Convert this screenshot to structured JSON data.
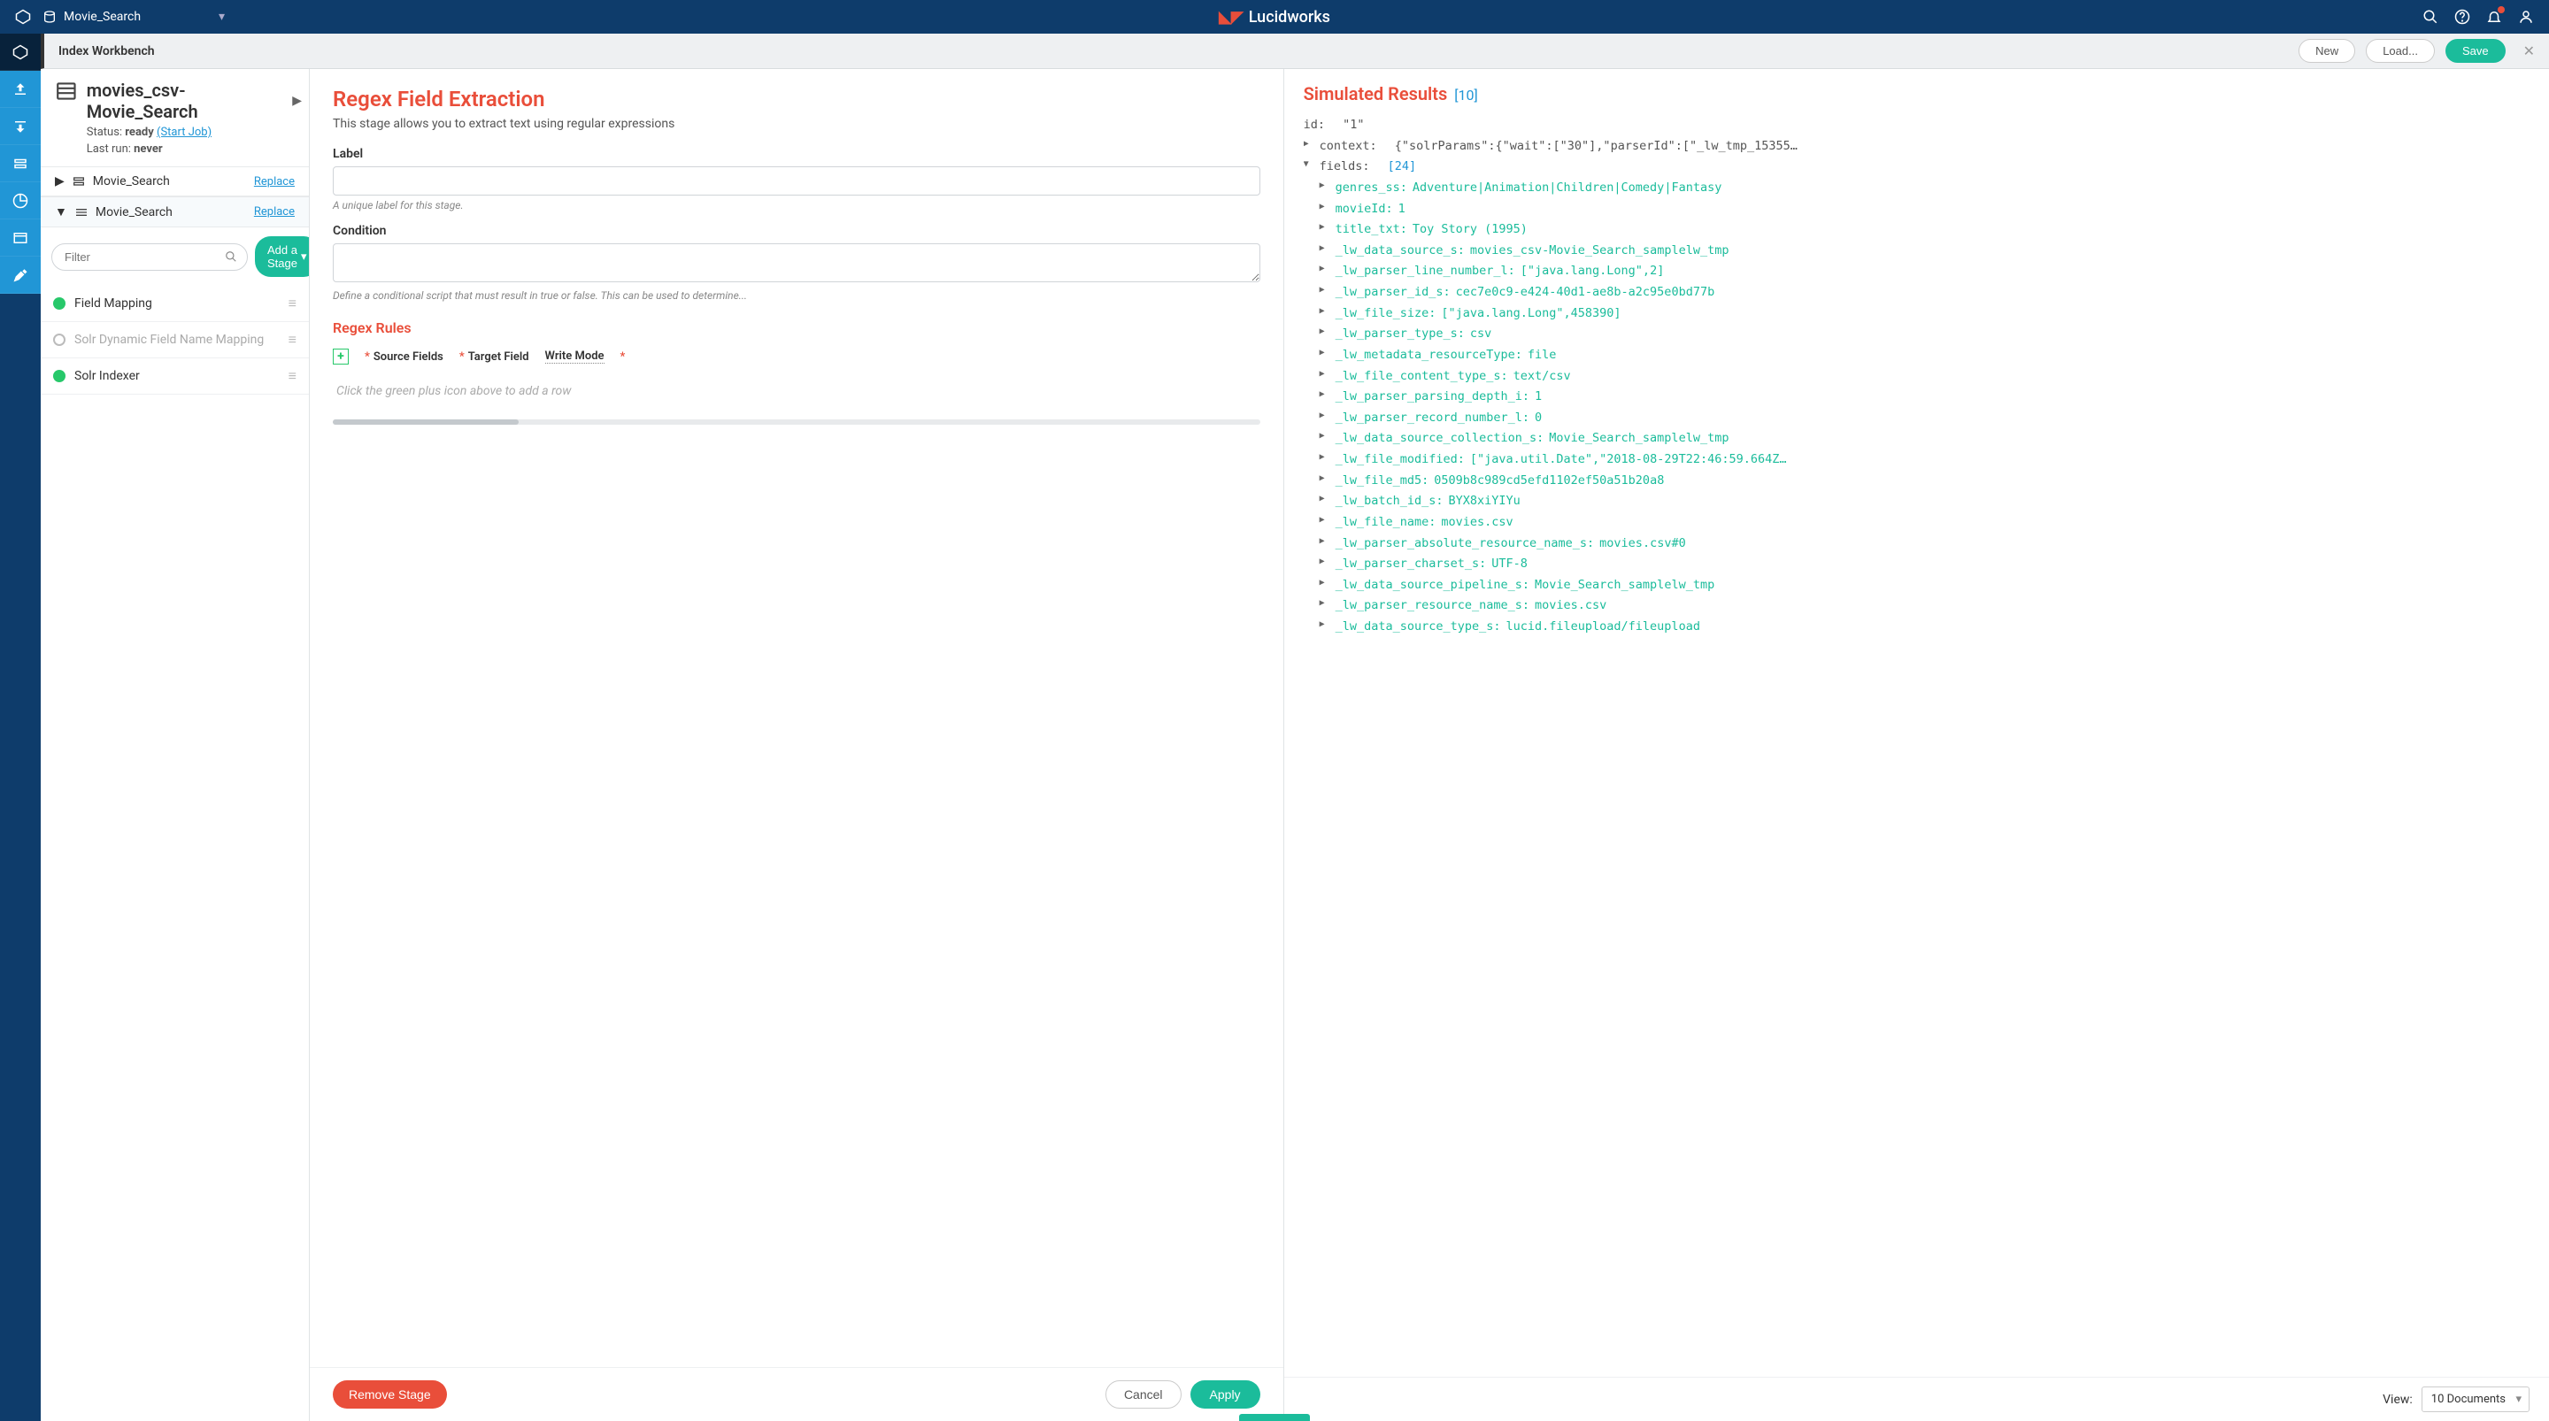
{
  "topbar": {
    "app_name": "Movie_Search",
    "brand": "Lucidworks"
  },
  "subbar": {
    "title": "Index Workbench",
    "new": "New",
    "load": "Load...",
    "save": "Save"
  },
  "datasource": {
    "title": "movies_csv-Movie_Search",
    "status_label": "Status:",
    "status_value": "ready",
    "start_job": "(Start Job)",
    "lastrun_label": "Last run:",
    "lastrun_value": "never"
  },
  "accordion": {
    "a1": "Movie_Search",
    "a2": "Movie_Search",
    "replace": "Replace"
  },
  "filter": {
    "placeholder": "Filter",
    "add_stage": "Add a Stage"
  },
  "stages": [
    {
      "label": "Field Mapping",
      "dim": false,
      "dot": "green"
    },
    {
      "label": "Solr Dynamic Field Name Mapping",
      "dim": true,
      "dot": "hollow"
    },
    {
      "label": "Solr Indexer",
      "dim": false,
      "dot": "green"
    }
  ],
  "form": {
    "title": "Regex Field Extraction",
    "desc": "This stage allows you to extract text using regular expressions",
    "label_label": "Label",
    "label_hint": "A unique label for this stage.",
    "condition_label": "Condition",
    "condition_hint": "Define a conditional script that must result in true or false. This can be used to determine...",
    "rules_title": "Regex Rules",
    "col_source": "Source Fields",
    "col_target": "Target Field",
    "col_write": "Write Mode",
    "rules_empty": "Click the green plus icon above to add a row",
    "remove": "Remove Stage",
    "cancel": "Cancel",
    "apply": "Apply"
  },
  "sim": {
    "title": "Simulated Results",
    "count": "[10]",
    "id_line_k": "id:",
    "id_line_v": "\"1\"",
    "context_k": "context:",
    "context_v": "{\"solrParams\":{\"wait\":[\"30\"],\"parserId\":[\"_lw_tmp_15355…",
    "fields_k": "fields:",
    "fields_count": "[24]",
    "rows": [
      {
        "k": "genres_ss:",
        "v": "Adventure|Animation|Children|Comedy|Fantasy"
      },
      {
        "k": "movieId:",
        "v": "1"
      },
      {
        "k": "title_txt:",
        "v": "Toy Story (1995)"
      },
      {
        "k": "_lw_data_source_s:",
        "v": "movies_csv-Movie_Search_samplelw_tmp"
      },
      {
        "k": "_lw_parser_line_number_l:",
        "v": "[\"java.lang.Long\",2]"
      },
      {
        "k": "_lw_parser_id_s:",
        "v": "cec7e0c9-e424-40d1-ae8b-a2c95e0bd77b"
      },
      {
        "k": "_lw_file_size:",
        "v": "[\"java.lang.Long\",458390]"
      },
      {
        "k": "_lw_parser_type_s:",
        "v": "csv"
      },
      {
        "k": "_lw_metadata_resourceType:",
        "v": "file"
      },
      {
        "k": "_lw_file_content_type_s:",
        "v": "text/csv"
      },
      {
        "k": "_lw_parser_parsing_depth_i:",
        "v": "1"
      },
      {
        "k": "_lw_parser_record_number_l:",
        "v": "0"
      },
      {
        "k": "_lw_data_source_collection_s:",
        "v": "Movie_Search_samplelw_tmp"
      },
      {
        "k": "_lw_file_modified:",
        "v": "[\"java.util.Date\",\"2018-08-29T22:46:59.664Z…"
      },
      {
        "k": "_lw_file_md5:",
        "v": "0509b8c989cd5efd1102ef50a51b20a8"
      },
      {
        "k": "_lw_batch_id_s:",
        "v": "BYX8xiYIYu"
      },
      {
        "k": "_lw_file_name:",
        "v": "movies.csv"
      },
      {
        "k": "_lw_parser_absolute_resource_name_s:",
        "v": "movies.csv#0"
      },
      {
        "k": "_lw_parser_charset_s:",
        "v": "UTF-8"
      },
      {
        "k": "_lw_data_source_pipeline_s:",
        "v": "Movie_Search_samplelw_tmp"
      },
      {
        "k": "_lw_parser_resource_name_s:",
        "v": "movies.csv"
      },
      {
        "k": "_lw_data_source_type_s:",
        "v": "lucid.fileupload/fileupload"
      }
    ],
    "view_label": "View:",
    "view_value": "10 Documents"
  }
}
